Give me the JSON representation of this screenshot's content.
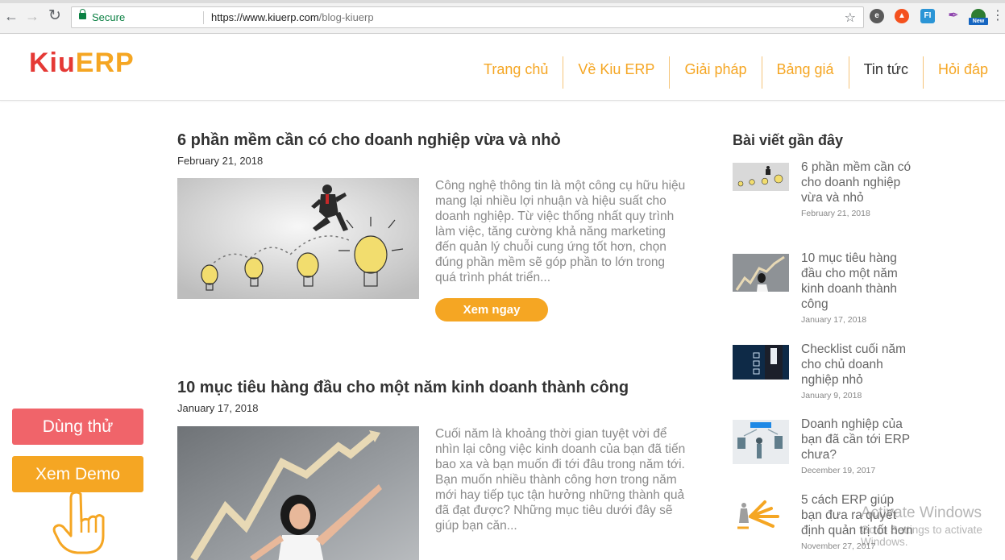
{
  "browser": {
    "secure_label": "Secure",
    "url_host": "https://www.kiuerp.com",
    "url_path": "/blog-kiuerp",
    "extensions": [
      "evernote-icon",
      "fire-icon",
      "fi-icon",
      "feather-icon",
      "new-badge-icon"
    ],
    "ext_new_badge": "New"
  },
  "header": {
    "logo_kiu": "Kiu",
    "logo_erp": "ERP",
    "menu": [
      {
        "label": "Trang chủ"
      },
      {
        "label": "Về Kiu ERP"
      },
      {
        "label": "Giải pháp"
      },
      {
        "label": "Bảng giá"
      },
      {
        "label": "Tin tức",
        "active": true
      },
      {
        "label": "Hỏi đáp"
      }
    ]
  },
  "posts": [
    {
      "title": "6 phần mềm cần có cho doanh nghiệp vừa và nhỏ",
      "date": "February 21, 2018",
      "excerpt": "Công nghệ thông tin là một công cụ hữu hiệu mang lại nhiều lợi nhuận và hiệu suất cho doanh nghiệp. Từ việc thống nhất quy trình làm việc, tăng cường khả năng marketing đến quản lý chuỗi cung ứng tốt hơn, chọn đúng phần mềm sẽ góp phần to lớn trong quá trình phát triển...",
      "button": "Xem ngay"
    },
    {
      "title": "10 mục tiêu hàng đầu cho một năm kinh doanh thành công",
      "date": "January 17, 2018",
      "excerpt": "Cuối năm là khoảng thời gian tuyệt vời để nhìn lại công việc kinh doanh của bạn đã tiến bao xa và bạn muốn đi tới đâu trong năm tới. Bạn muốn nhiều thành công hơn trong năm mới hay tiếp tục tận hưởng những thành quả đã đạt được? Những mục tiêu dưới đây sẽ giúp bạn căn..."
    }
  ],
  "sidebar": {
    "title": "Bài viết gần đây",
    "items": [
      {
        "title": "6 phần mềm cần có cho doanh nghiệp vừa và nhỏ",
        "date": "February 21, 2018"
      },
      {
        "title": "10 mục tiêu hàng đầu cho một năm kinh doanh thành công",
        "date": "January 17, 2018"
      },
      {
        "title": "Checklist cuối năm cho chủ doanh nghiệp nhỏ",
        "date": "January 9, 2018"
      },
      {
        "title": "Doanh nghiệp của bạn đã cần tới ERP chưa?",
        "date": "December 19, 2017"
      },
      {
        "title": "5 cách ERP giúp bạn đưa ra quyết định quản trị tốt hơn",
        "date": "November 27, 2017"
      }
    ]
  },
  "cta": {
    "try": "Dùng thử",
    "demo": "Xem Demo"
  },
  "watermark": {
    "line1": "Activate Windows",
    "line2": "Go to Settings to activate Windows."
  }
}
